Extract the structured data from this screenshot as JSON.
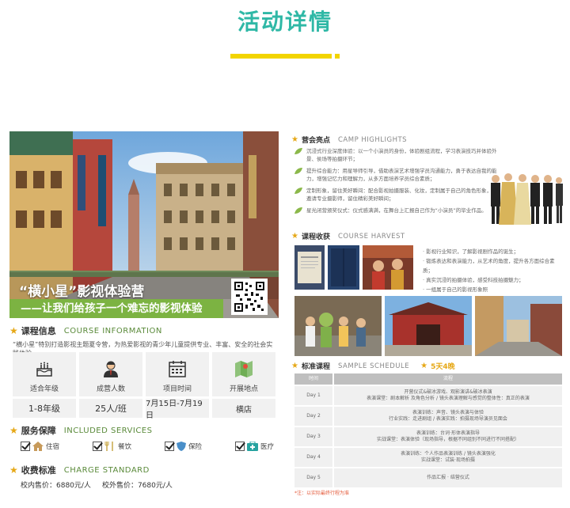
{
  "header": {
    "title": "活动详情"
  },
  "banner": {
    "title": "“横小星”影视体验营",
    "subtitle": "——让我们给孩子一个难忘的影视体验"
  },
  "course_info": {
    "heading_cn": "课程信息",
    "heading_en": "COURSE INFORMATION",
    "description": "“横小星”特别打造影视主题夏令营，为热爱影视的青少年儿童提供专业、丰富、安全的社会实践体验。",
    "cards": [
      {
        "label": "适合年级",
        "value": "1-8年级",
        "icon": "cake-icon"
      },
      {
        "label": "成营人数",
        "value": "25人/班",
        "icon": "person-icon"
      },
      {
        "label": "项目时间",
        "value": "7月15日-7月19日",
        "icon": "calendar-icon"
      },
      {
        "label": "开展地点",
        "value": "横店",
        "icon": "map-icon"
      }
    ]
  },
  "services": {
    "heading_cn": "服务保障",
    "heading_en": "INCLUDED SERVICES",
    "items": [
      {
        "label": "住宿",
        "icon": "house-icon"
      },
      {
        "label": "餐饮",
        "icon": "dining-icon"
      },
      {
        "label": "保险",
        "icon": "shield-icon"
      },
      {
        "label": "医疗",
        "icon": "medical-icon"
      }
    ]
  },
  "charge": {
    "heading_cn": "收费标准",
    "heading_en": "CHARGE STANDARD",
    "inside": "校内售价：6880元/人",
    "outside": "校外售价：7680元/人"
  },
  "highlights": {
    "heading_cn": "营会亮点",
    "heading_en": "CAMP HIGHLIGHTS",
    "items": [
      "沉浸式行业深度体验：以一个小演员的身份，体验剧组流程，学习表演技巧并体验外景、侯场等拍摄环节；",
      "提升综合能力：用星导师引导，借助表演艺术增强学员沟通能力，勇于表达自我的能力，增强记忆力和理解力，从多方面培养学员综合素质；",
      "定制形象，留住美好瞬间：配合影视拍摄服装、化妆，定制属于自己的角色形象，并邀请专业摄影师，留住精彩美好瞬间；",
      "星光闭营颁奖仪式：仪式感满满，在舞台上汇报自己作为“小演员”的毕业作品。"
    ]
  },
  "harvest": {
    "heading_cn": "课程收获",
    "heading_en": "COURSE HARVEST",
    "items": [
      "· 影视行业知识，了解影视剧作品的诞生；",
      "· 锻炼表达和表演能力，从艺术的角度，提升各方面综合素质；",
      "· 真实沉浸的拍摄体验，感受科技拍摄魅力；",
      "· 一组属于自己的影视形象照"
    ]
  },
  "schedule": {
    "heading_cn": "标准课程",
    "heading_en": "SAMPLE SCHEDULE",
    "days_badge": "5天4晚",
    "col_time": "时间",
    "col_content": "流程",
    "rows": [
      {
        "day": "Day 1",
        "lines": [
          "开营仪式&破冰游戏、观影演讲&破冰表演",
          "表演课堂：剧本解析 及角色分析 / 镜头表演理解与感觉的整体性：真正的表演"
        ]
      },
      {
        "day": "Day 2",
        "lines": [
          "表演训练：声音、镜头表演与体验",
          "行业实践：走进剧组 / 表演实践：拍摄现场导演员见面会"
        ]
      },
      {
        "day": "Day 3",
        "lines": [
          "表演训练：台词·形体表演指导",
          "实战课堂：表演体验（现场指导，根据不同组别不同进行不同搭配）"
        ]
      },
      {
        "day": "Day 4",
        "lines": [
          "表演训练：个人作品表演训练 / 镜头表演强化",
          "实战课堂：试装·现场拍摄"
        ]
      },
      {
        "day": "Day 5",
        "lines": [
          "作品汇报 · 结营仪式"
        ]
      }
    ],
    "note": "*注：以实际最终行程为准"
  },
  "colors": {
    "title_teal": "#2fb8a6",
    "accent_yellow": "#f2d400",
    "banner_green": "#7cb342"
  }
}
